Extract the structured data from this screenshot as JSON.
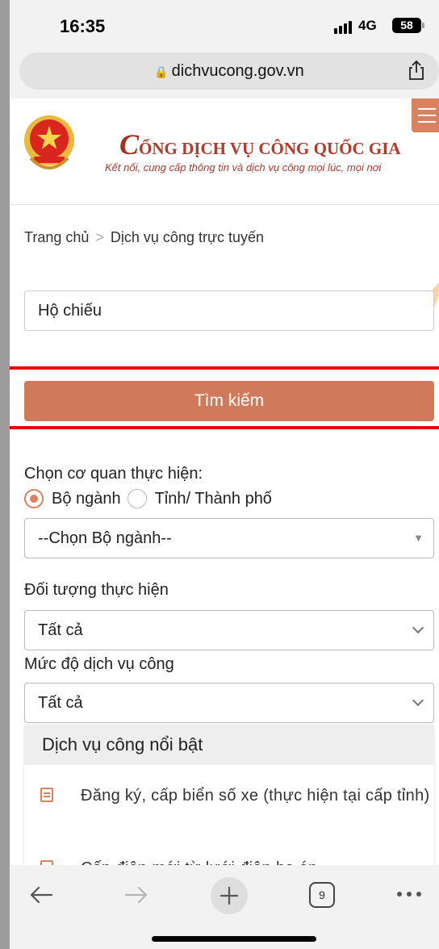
{
  "status_bar": {
    "time": "16:35",
    "network": "4G",
    "battery": "58"
  },
  "browser": {
    "url": "dichvucong.gov.vn",
    "tab_count": "9"
  },
  "header": {
    "title_initial": "C",
    "title_rest": "ỔNG DỊCH VỤ CÔNG QUỐC GIA",
    "subtitle": "Kết nối, cung cấp thông tin và dịch vụ công mọi lúc, mọi nơi"
  },
  "breadcrumb": {
    "home": "Trang chủ",
    "separator": ">",
    "current": "Dịch vụ công trực tuyến"
  },
  "search": {
    "value": "Hộ chiếu",
    "button_label": "Tìm kiếm"
  },
  "agency": {
    "label": "Chọn cơ quan thực hiện:",
    "option_ministry": "Bộ ngành",
    "option_province": "Tỉnh/ Thành phố",
    "selected": "ministry",
    "select_value": "--Chọn Bộ ngành--"
  },
  "subject": {
    "label": "Đối tượng thực hiện",
    "value": "Tất cả"
  },
  "level": {
    "label": "Mức độ dịch vụ công",
    "value": "Tất cả"
  },
  "featured": {
    "title": "Dịch vụ công nổi bật",
    "items": [
      {
        "text": "Đăng ký, cấp biển số xe (thực hiện tại cấp tỉnh)"
      },
      {
        "text": "Cấp điện mới từ lưới điện hạ áp"
      }
    ]
  },
  "colors": {
    "accent": "#cf7a5a",
    "brand": "#b23a2c",
    "highlight": "#e80000"
  }
}
